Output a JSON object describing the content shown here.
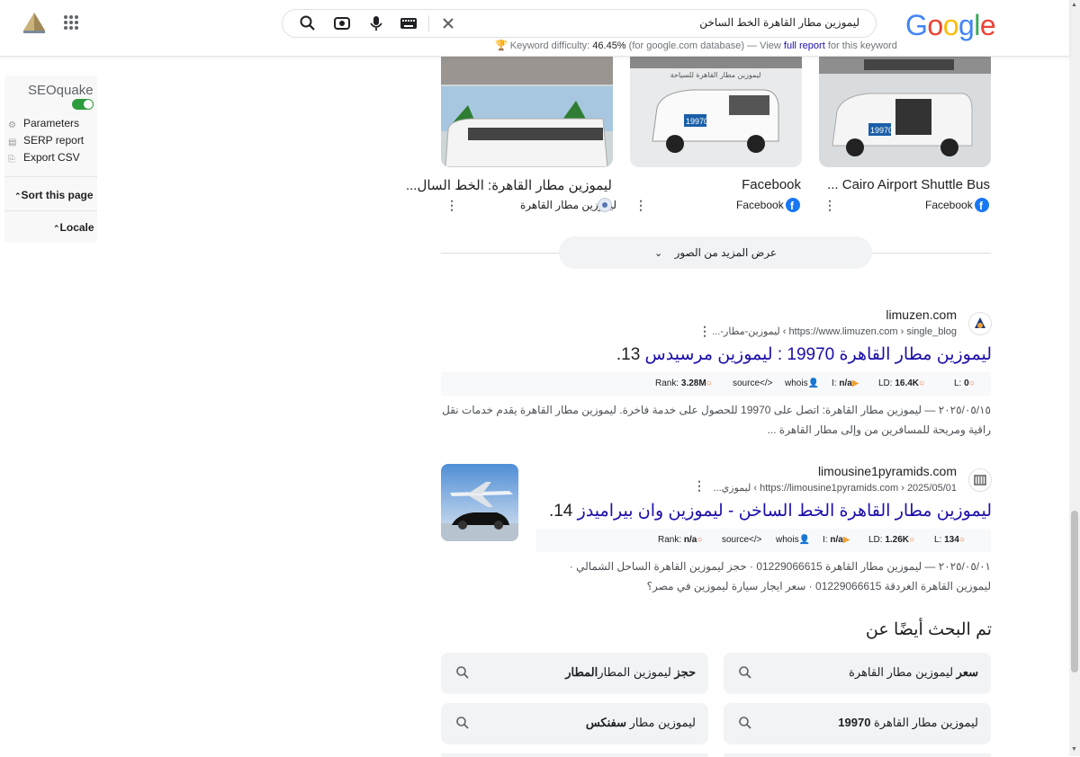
{
  "header": {
    "query": "ليموزين مطار القاهرة الخط الساخن",
    "keyword_difficulty_label": "Keyword difficulty:",
    "keyword_difficulty_value": "46.45%",
    "kd_db": "(for google.com database) — View",
    "kd_link": "full report",
    "kd_tail": "for this keyword",
    "logo_letters": [
      "G",
      "o",
      "o",
      "g",
      "l",
      "e"
    ],
    "logo_colors": [
      "#4285F4",
      "#EA4335",
      "#FBBC05",
      "#4285F4",
      "#34A853",
      "#EA4335"
    ]
  },
  "seoquake": {
    "title": "SEOquake",
    "items": [
      "Parameters",
      "SERP report",
      "Export CSV"
    ],
    "sort": "Sort this page",
    "locale": "Locale"
  },
  "images": [
    {
      "title": "Cairo Airport Shuttle Bus ...",
      "source": "Facebook"
    },
    {
      "title": "Facebook",
      "source": "Facebook"
    },
    {
      "title": "ليموزين مطار القاهرة: الخط السال...",
      "source": "ليموزين مطار القاهرة"
    }
  ],
  "image_sign_text": "ليموزين مطار القاهرة للسياحة",
  "van_number": "19970",
  "more_images": "عرض المزيد من الصور",
  "results": [
    {
      "site": "limuzen.com",
      "url": "https://www.limuzen.com › single_blog › ليموزين-مطار-...",
      "title": "ليموزين مطار القاهرة 19970 : ليموزين مرسيدس",
      "number": "13.",
      "metrics": {
        "rank_label": "Rank:",
        "rank": "3.28M",
        "source": "source",
        "whois": "whois",
        "i_label": "I:",
        "i": "n/a",
        "ld_label": "LD:",
        "ld": "16.4K",
        "l_label": "L:",
        "l": "0"
      },
      "snippet": "٢٠٢٥/٠٥/١٥ — ليموزين مطار القاهرة: اتصل على 19970 للحصول على خدمة فاخرة. ليموزين مطار القاهرة يقدم خدمات نقل راقية ومريحة للمسافرين من وإلى مطار القاهرة ..."
    },
    {
      "site": "limousine1pyramids.com",
      "url": "https://limousine1pyramids.com › 2025/05/01 › ليموزي...",
      "title": "ليموزين مطار القاهرة الخط الساخن - ليموزين وان بيراميدز",
      "number": "14.",
      "metrics": {
        "rank_label": "Rank:",
        "rank": "n/a",
        "source": "source",
        "whois": "whois",
        "i_label": "I:",
        "i": "n/a",
        "ld_label": "LD:",
        "ld": "1.26K",
        "l_label": "L:",
        "l": "134"
      },
      "snippet": "٢٠٢٥/٠٥/٠١ — ليموزين مطار القاهرة 01229066615 · حجز ليموزين القاهرة الساحل الشمالي · ليموزين القاهرة الغردقة 01229066615 · سعر ايجار سيارة ليموزين في مصر؟"
    }
  ],
  "related": {
    "heading": "تم البحث أيضًا عن",
    "items": [
      {
        "bold": "سعر",
        "text": " ليموزين مطار القاهرة"
      },
      {
        "bold": "حجز",
        "text": " ليموزين المطار"
      },
      {
        "bold": "",
        "text": "ليموزين مطار القاهرة ",
        "tail": "19970"
      },
      {
        "bold": "",
        "text": "ليموزين مطار ",
        "tail": "سفنكس"
      }
    ]
  },
  "colors": {
    "link": "#1a0dab",
    "seo_icon": "#f0703c",
    "toggle_green": "#2e9c3d"
  }
}
